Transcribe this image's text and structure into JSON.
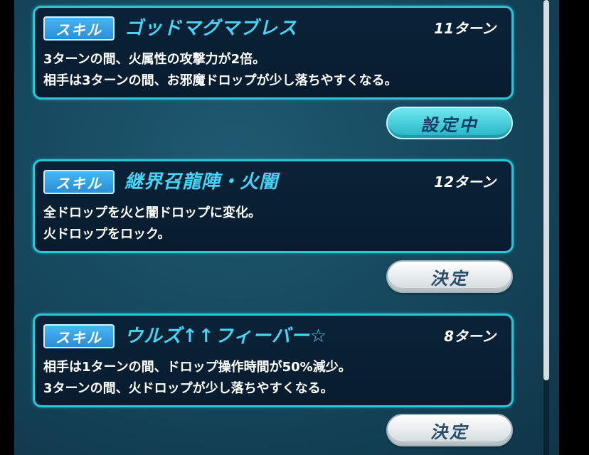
{
  "skills": [
    {
      "badge": "スキル",
      "name": "ゴッドマグマブレス",
      "turns": "11ターン",
      "desc_line1": "3ターンの間、火属性の攻撃力が2倍。",
      "desc_line2": "相手は3ターンの間、お邪魔ドロップが少し落ちやすくなる。",
      "button": "設定中",
      "button_state": "active"
    },
    {
      "badge": "スキル",
      "name": "継界召龍陣・火闇",
      "turns": "12ターン",
      "desc_line1": "全ドロップを火と闇ドロップに変化。",
      "desc_line2": "火ドロップをロック。",
      "button": "決定",
      "button_state": "normal"
    },
    {
      "badge": "スキル",
      "name": "ウルズ↑↑フィーバー☆",
      "turns": "8ターン",
      "desc_line1": "相手は1ターンの間、ドロップ操作時間が50%減少。",
      "desc_line2": "3ターンの間、火ドロップが少し落ちやすくなる。",
      "button": "決定",
      "button_state": "normal"
    }
  ],
  "colors": {
    "panel_border": "#27c9d8",
    "skill_name": "#45d4f5",
    "badge": "#2b8ed6",
    "active_button": "#24b3c6"
  }
}
